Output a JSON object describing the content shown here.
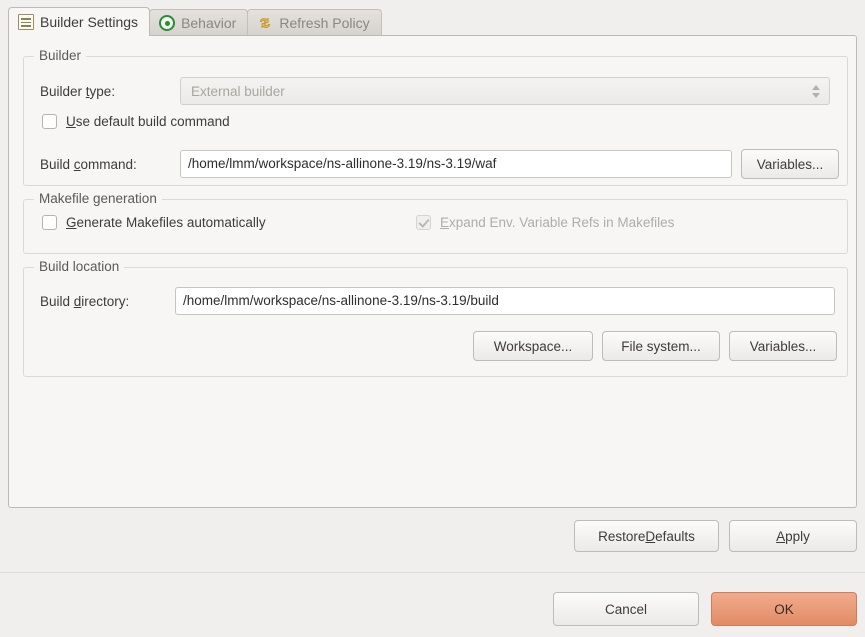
{
  "tabs": [
    {
      "label": "Builder Settings",
      "icon": "list-icon",
      "active": true
    },
    {
      "label": "Behavior",
      "icon": "target-icon",
      "active": false
    },
    {
      "label": "Refresh Policy",
      "icon": "refresh-arrows-icon",
      "active": false
    }
  ],
  "builder_group": {
    "title": "Builder",
    "builder_type_label_pre": "Builder ",
    "builder_type_label_mnemonic": "t",
    "builder_type_label_post": "ype:",
    "builder_type_value": "External builder",
    "use_default_build_command": {
      "checked": false,
      "label_pre": "",
      "label_mnemonic": "U",
      "label_post": "se default build command"
    },
    "build_command_label_pre": "Build ",
    "build_command_label_mnemonic": "c",
    "build_command_label_post": "ommand:",
    "build_command_value": "/home/lmm/workspace/ns-allinone-3.19/ns-3.19/waf",
    "variables_button": "Variables..."
  },
  "makefile_group": {
    "title": "Makefile generation",
    "generate_makefiles": {
      "checked": false,
      "label_pre": "",
      "label_mnemonic": "G",
      "label_post": "enerate Makefiles automatically"
    },
    "expand_env": {
      "checked": true,
      "disabled": true,
      "label_pre": "",
      "label_mnemonic": "E",
      "label_post": "xpand Env. Variable Refs in Makefiles"
    }
  },
  "location_group": {
    "title": "Build location",
    "build_directory_label_pre": "Build ",
    "build_directory_label_mnemonic": "d",
    "build_directory_label_post": "irectory:",
    "build_directory_value": "/home/lmm/workspace/ns-allinone-3.19/ns-3.19/build",
    "workspace_button": "Workspace...",
    "file_system_button": "File system...",
    "variables_button": "Variables..."
  },
  "footer": {
    "restore_defaults_pre": "Restore ",
    "restore_defaults_mnemonic": "D",
    "restore_defaults_post": "efaults",
    "apply_pre": "",
    "apply_mnemonic": "A",
    "apply_post": "pply",
    "cancel": "Cancel",
    "ok": "OK"
  },
  "colors": {
    "dialog_background": "#f0efee",
    "panel_background": "#f7f6f5",
    "panel_border": "#bdb9b4",
    "accent_primary": "#e08c65",
    "text": "#3c3c3c",
    "disabled_text": "#a9a6a1",
    "tab_icon_green": "#2e8b36",
    "tab_icon_yellow": "#e0a93b"
  }
}
